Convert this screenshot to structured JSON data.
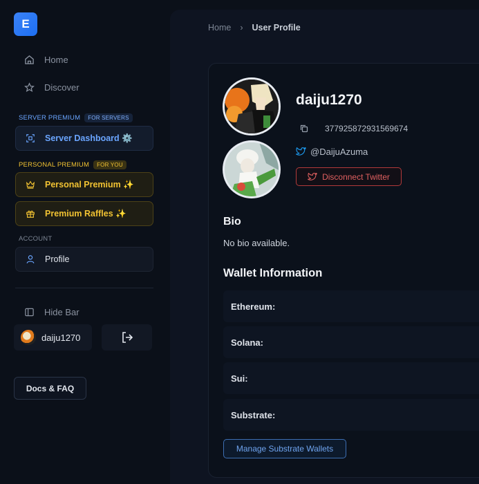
{
  "sidebar": {
    "logo_letter": "E",
    "nav": [
      {
        "label": "Home",
        "icon": "home-icon"
      },
      {
        "label": "Discover",
        "icon": "star-icon"
      }
    ],
    "server_premium": {
      "label": "SERVER PREMIUM",
      "badge": "FOR SERVERS",
      "color": "#6aa5ff"
    },
    "server_dashboard": {
      "label": "Server Dashboard ⚙️",
      "icon": "grid-scan-icon"
    },
    "personal_premium": {
      "label": "PERSONAL PREMIUM",
      "badge": "FOR YOU",
      "color": "#f1c232"
    },
    "personal_premium_btn": {
      "label": "Personal Premium ✨",
      "icon": "crown-icon"
    },
    "premium_raffles_btn": {
      "label": "Premium Raffles ✨",
      "icon": "gift-icon"
    },
    "account": {
      "label": "ACCOUNT"
    },
    "profile_btn": {
      "label": "Profile",
      "icon": "user-icon"
    },
    "hide_bar": {
      "label": "Hide Bar",
      "icon": "sidebar-icon"
    },
    "user_chip": {
      "name": "daiju1270"
    },
    "docs_btn": {
      "label": "Docs & FAQ"
    }
  },
  "breadcrumb": {
    "home": "Home",
    "separator": "›",
    "current": "User Profile"
  },
  "profile": {
    "username": "daiju1270",
    "user_id": "377925872931569674",
    "twitter_handle": "@DaijuAzuma",
    "disconnect_label": "Disconnect Twitter",
    "bio_title": "Bio",
    "bio_text": "No bio available.",
    "wallet_title": "Wallet Information",
    "wallets": [
      {
        "label": "Ethereum:"
      },
      {
        "label": "Solana:"
      },
      {
        "label": "Sui:"
      },
      {
        "label": "Substrate:"
      }
    ],
    "manage_substrate_label": "Manage Substrate Wallets"
  },
  "colors": {
    "accent_blue": "#3b82f6",
    "premium_gold": "#f1c232",
    "danger_red": "#e06060",
    "twitter_blue": "#1d9bf0"
  }
}
